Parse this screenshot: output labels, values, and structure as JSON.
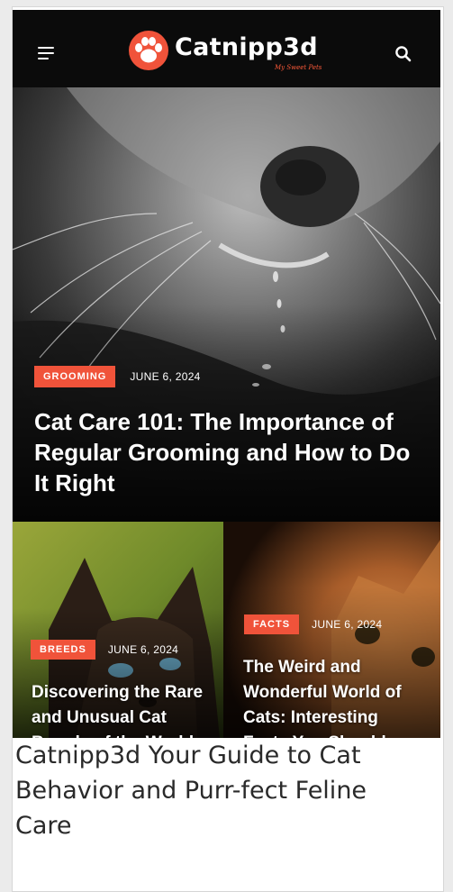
{
  "header": {
    "logo_text": "Catnipp3d",
    "logo_tagline": "My Sweet Pets",
    "menu_icon": "hamburger-menu-icon",
    "search_icon": "search-icon"
  },
  "hero": {
    "category": "GROOMING",
    "date": "JUNE 6, 2024",
    "title": "Cat Care 101: The Importance of Regular Grooming and How to Do It Right"
  },
  "cards": [
    {
      "category": "BREEDS",
      "date": "JUNE 6, 2024",
      "title": "Discovering the Rare and Unusual Cat Breeds of the World"
    },
    {
      "category": "FACTS",
      "date": "JUNE 6, 2024",
      "title": "The Weird and Wonderful World of Cats: Interesting Facts You Should Know"
    }
  ],
  "caption": "Catnipp3d Your Guide to Cat Behavior and Purr-fect Feline Care",
  "colors": {
    "accent": "#f0533a",
    "header_bg": "#0b0b0b",
    "text_light": "#ffffff",
    "caption_text": "#2a2a2a"
  }
}
